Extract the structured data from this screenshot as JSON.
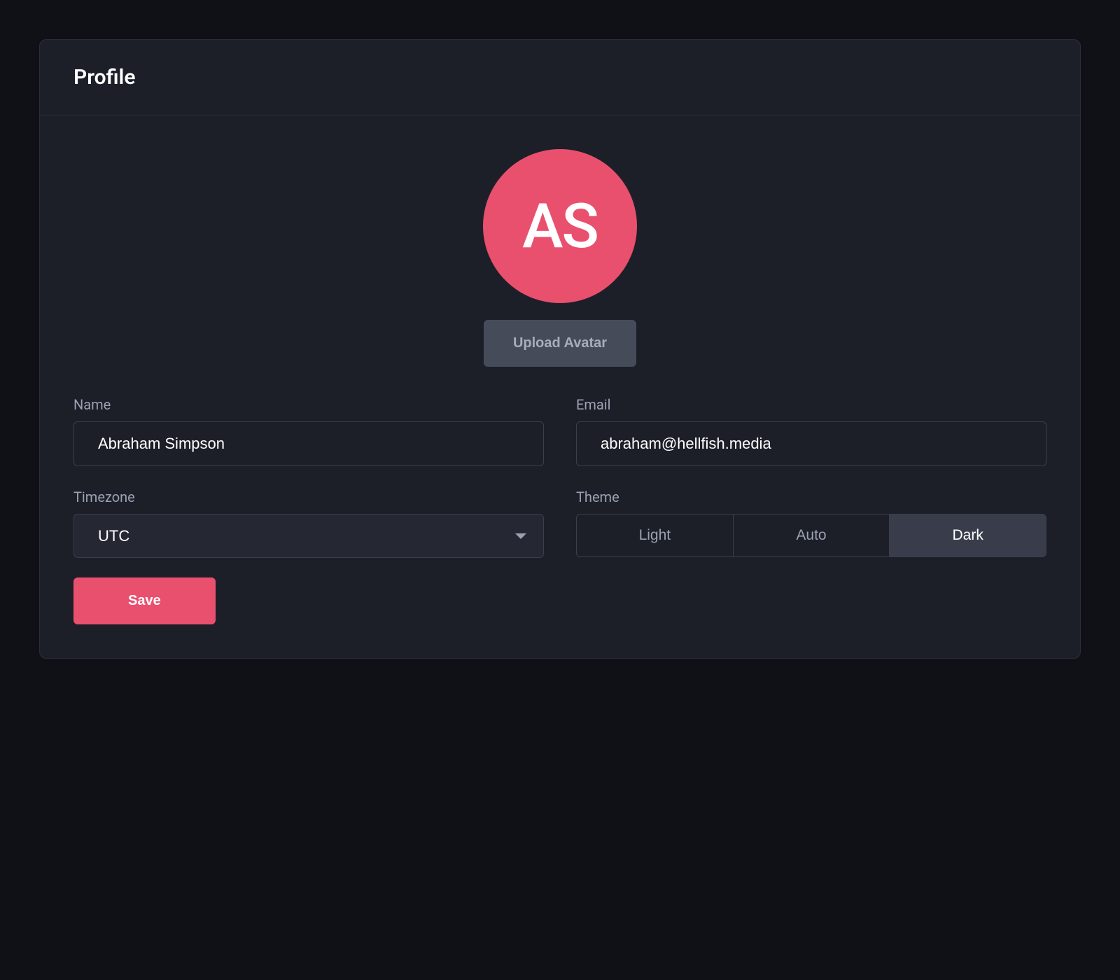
{
  "header": {
    "title": "Profile"
  },
  "avatar": {
    "initials": "AS",
    "upload_label": "Upload Avatar"
  },
  "form": {
    "name_label": "Name",
    "name_value": "Abraham Simpson",
    "email_label": "Email",
    "email_value": "abraham@hellfish.media",
    "timezone_label": "Timezone",
    "timezone_value": "UTC",
    "theme_label": "Theme",
    "theme_options": {
      "light": "Light",
      "auto": "Auto",
      "dark": "Dark"
    },
    "theme_selected": "dark",
    "save_label": "Save"
  },
  "colors": {
    "accent": "#e9506e",
    "background": "#0f1117",
    "card": "#1c1f28",
    "border": "#2a2e3a"
  }
}
